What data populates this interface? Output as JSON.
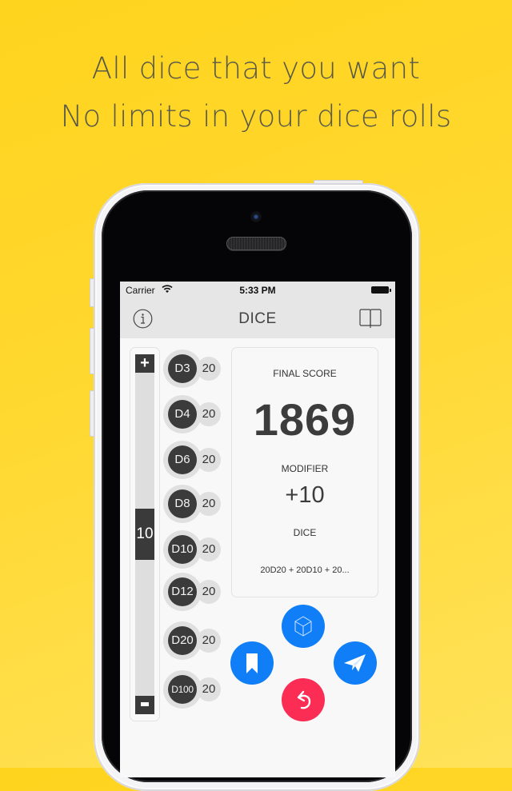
{
  "marketing": {
    "headline_line1": "All dice that you want",
    "headline_line2": "No limits in your dice rolls",
    "background_color": "#ffd726"
  },
  "status_bar": {
    "carrier": "Carrier",
    "time": "5:33 PM",
    "wifi_icon": "wifi-icon",
    "battery_icon": "battery-full-icon"
  },
  "nav_bar": {
    "title": "DICE",
    "left_icon": "info-icon",
    "right_icon": "book-icon"
  },
  "stepper": {
    "increment_label": "+",
    "decrement_icon": "minus-icon",
    "value": "10",
    "value_fraction": 0.5
  },
  "dice": [
    {
      "label": "D3",
      "count": "20"
    },
    {
      "label": "D4",
      "count": "20"
    },
    {
      "label": "D6",
      "count": "20"
    },
    {
      "label": "D8",
      "count": "20"
    },
    {
      "label": "D10",
      "count": "20"
    },
    {
      "label": "D12",
      "count": "20"
    },
    {
      "label": "D20",
      "count": "20"
    },
    {
      "label": "D100",
      "count": "20"
    }
  ],
  "score": {
    "final_label": "FINAL SCORE",
    "final_value": "1869",
    "modifier_label": "MODIFIER",
    "modifier_value": "+10",
    "dice_label": "DICE",
    "dice_expression": "20D20 + 20D10 + 20..."
  },
  "actions": {
    "roll_icon": "cube-icon",
    "save_icon": "bookmark-icon",
    "share_icon": "paper-plane-icon",
    "reset_icon": "undo-icon",
    "primary_color": "#0f7ef7",
    "danger_color": "#fb2d55"
  }
}
